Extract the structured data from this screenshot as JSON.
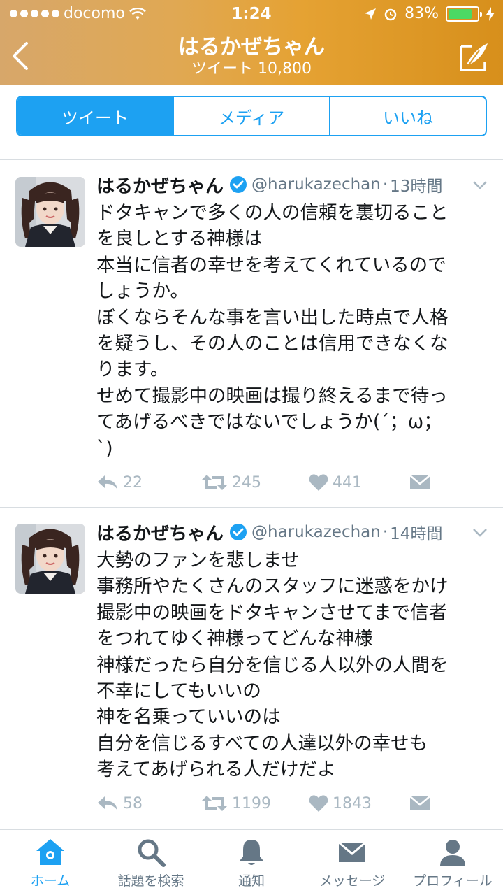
{
  "status_bar": {
    "carrier": "docomo",
    "time": "1:24",
    "battery": "83%",
    "battery_level": 0.83
  },
  "nav": {
    "title": "はるかぜちゃん",
    "subtitle": "ツイート 10,800"
  },
  "segments": [
    {
      "label": "ツイート",
      "active": true
    },
    {
      "label": "メディア",
      "active": false
    },
    {
      "label": "いいね",
      "active": false
    }
  ],
  "tweets": [
    {
      "name": "はるかぜちゃん",
      "handle": "@harukazechan",
      "separator": "·",
      "time": "13時間",
      "lines": [
        "ドタキャンで多くの人の信頼を裏切ること",
        "を良しとする神様は",
        "本当に信者の幸せを考えてくれているので",
        "しょうか。",
        "ぼくならそんな事を言い出した時点で人格",
        "を疑うし、その人のことは信用できなくな",
        "ります。",
        "せめて撮影中の映画は撮り終えるまで待っ",
        "てあげるべきではないでしょうか(´；ω；",
        "`)"
      ],
      "replies": "22",
      "retweets": "245",
      "likes": "441"
    },
    {
      "name": "はるかぜちゃん",
      "handle": "@harukazechan",
      "separator": "·",
      "time": "14時間",
      "lines": [
        "大勢のファンを悲しませ",
        "事務所やたくさんのスタッフに迷惑をかけ",
        "撮影中の映画をドタキャンさせてまで信者",
        "をつれてゆく神様ってどんな神様",
        "神様だったら自分を信じる人以外の人間を",
        "不幸にしてもいいの",
        "神を名乗っていいのは",
        "自分を信じるすべての人達以外の幸せも",
        "考えてあげられる人だけだよ"
      ],
      "replies": "58",
      "retweets": "1199",
      "likes": "1843"
    }
  ],
  "tabbar": [
    {
      "label": "ホーム",
      "icon": "home-icon",
      "active": true
    },
    {
      "label": "話題を検索",
      "icon": "search-icon",
      "active": false
    },
    {
      "label": "通知",
      "icon": "bell-icon",
      "active": false
    },
    {
      "label": "メッセージ",
      "icon": "envelope-icon",
      "active": false
    },
    {
      "label": "プロフィール",
      "icon": "person-icon",
      "active": false
    }
  ],
  "colors": {
    "accent": "#1da1f2",
    "header": "#e3a240",
    "muted": "#aab8c2",
    "text": "#14171a"
  }
}
